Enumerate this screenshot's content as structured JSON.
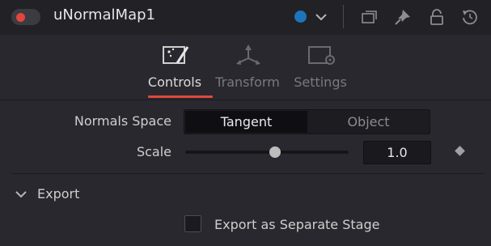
{
  "header": {
    "title": "uNormalMap1",
    "enabled": true,
    "toggle_color": "#e2453c",
    "color_swatch": "#1e74b8",
    "icons": [
      "versions-icon",
      "pin-icon",
      "lock-icon",
      "reset-icon"
    ]
  },
  "tabs": [
    {
      "label": "Controls",
      "active": true
    },
    {
      "label": "Transform",
      "active": false
    },
    {
      "label": "Settings",
      "active": false
    }
  ],
  "controls": {
    "normals_space": {
      "label": "Normals Space",
      "options": [
        "Tangent",
        "Object"
      ],
      "selected": "Tangent"
    },
    "scale": {
      "label": "Scale",
      "value": "1.0",
      "slider_fraction": 0.55
    }
  },
  "export": {
    "section_label": "Export",
    "expanded": true,
    "checkbox_label": "Export as Separate Stage",
    "checked": false
  }
}
